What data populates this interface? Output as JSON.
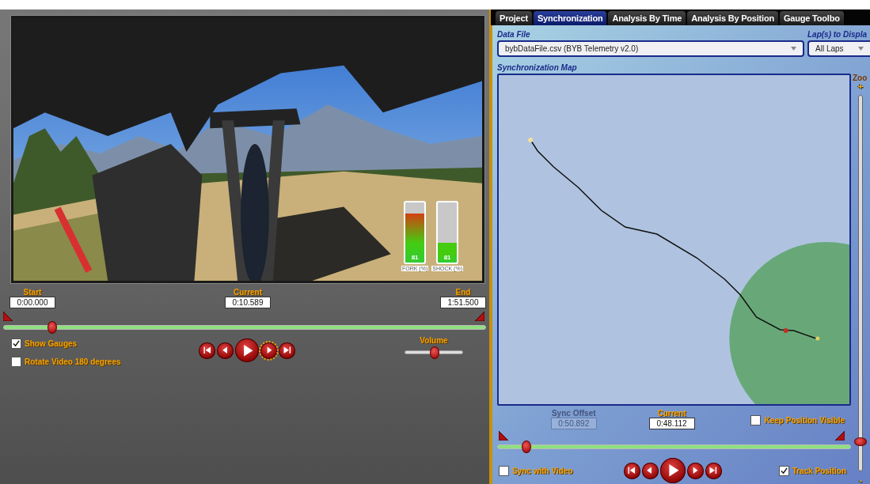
{
  "video": {
    "gauges": [
      {
        "label": "FORK (%)",
        "reading": "81",
        "level": 0.82
      },
      {
        "label": "SHOCK (%)",
        "reading": "81",
        "level": 0.33
      }
    ],
    "start": {
      "label": "Start",
      "value": "0:00.000"
    },
    "current": {
      "label": "Current",
      "value": "0:10.589"
    },
    "end": {
      "label": "End",
      "value": "1:51.500"
    },
    "timeline": {
      "level": 0.1
    },
    "options": [
      {
        "label": "Show Gauges",
        "checked": true
      },
      {
        "label": "Rotate Video 180 degrees",
        "checked": false
      }
    ],
    "transport": [
      {
        "kind": "first",
        "focused": false
      },
      {
        "kind": "prev",
        "focused": false
      },
      {
        "kind": "play",
        "focused": false
      },
      {
        "kind": "next",
        "focused": true
      },
      {
        "kind": "last",
        "focused": false
      }
    ],
    "volume": {
      "label": "Volume",
      "level": 0.5
    }
  },
  "tabs": [
    {
      "label": "Project",
      "selected": false
    },
    {
      "label": "Synchronization",
      "selected": true
    },
    {
      "label": "Analysis By Time",
      "selected": false
    },
    {
      "label": "Analysis By Position",
      "selected": false
    },
    {
      "label": "Gauge Toolbo",
      "selected": false
    }
  ],
  "sync": {
    "data_file": {
      "label": "Data File",
      "value": "bybDataFile.csv (BYB Telemetry v2.0)"
    },
    "laps": {
      "label": "Lap(s) to Displa",
      "value": "All Laps"
    },
    "map": {
      "title": "Synchronization Map"
    },
    "zoom": {
      "label": "Zoo",
      "plus": "+",
      "minus": "-",
      "level": 0.08
    },
    "sync_offset": {
      "label": "Sync Offset",
      "value": "0:50.892",
      "disabled": true
    },
    "current": {
      "label": "Current",
      "value": "0:48.112"
    },
    "keep_position_visible": {
      "label": "Keep Position Visible",
      "checked": false
    },
    "timeline": {
      "level": 0.08
    },
    "sync_with_video": {
      "label": "Sync with Video",
      "checked": false
    },
    "transport": [
      {
        "kind": "first",
        "focused": false
      },
      {
        "kind": "prev",
        "focused": false
      },
      {
        "kind": "play",
        "focused": false
      },
      {
        "kind": "next",
        "focused": false
      },
      {
        "kind": "last",
        "focused": false
      }
    ],
    "track_position": {
      "label": "Track Position",
      "checked": true
    }
  }
}
